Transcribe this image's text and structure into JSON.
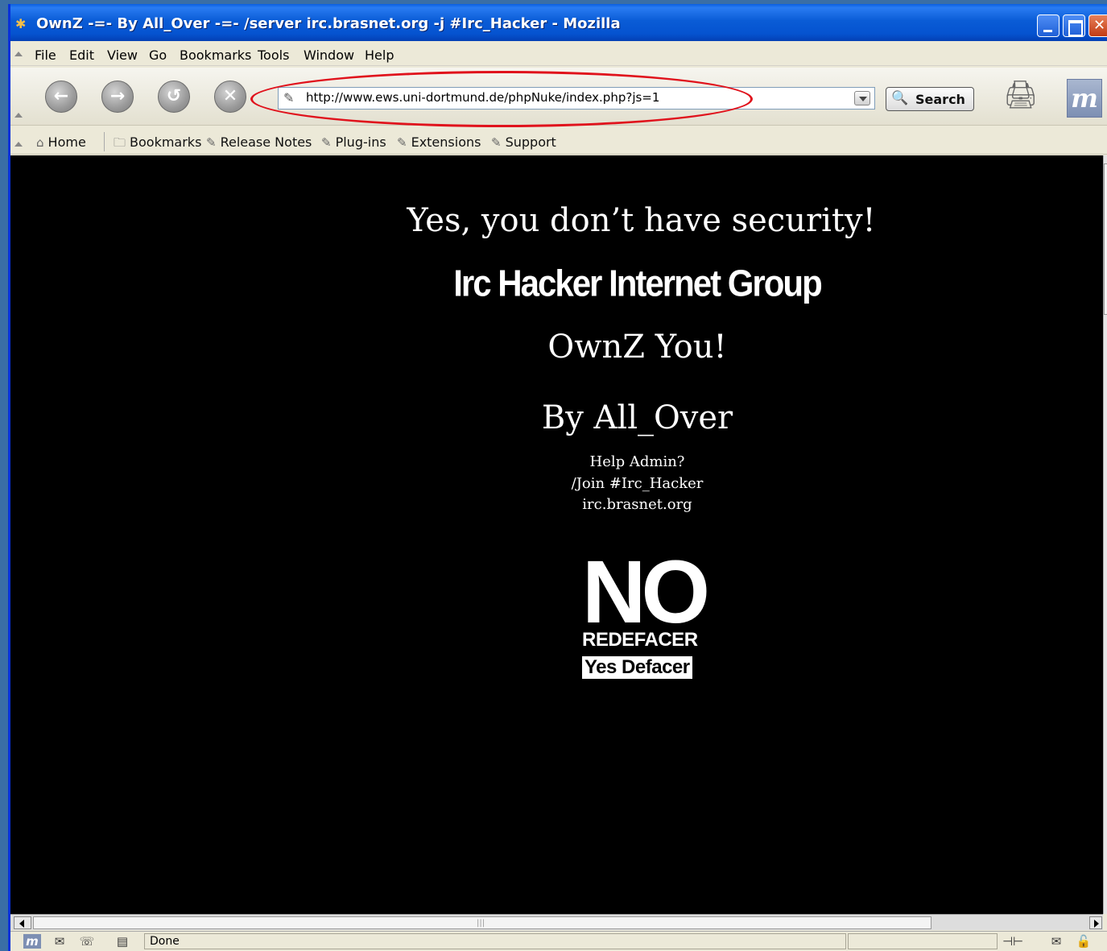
{
  "window": {
    "title": "OwnZ -=- By All_Over -=- /server irc.brasnet.org -j #Irc_Hacker - Mozilla"
  },
  "menu": {
    "items": [
      "File",
      "Edit",
      "View",
      "Go",
      "Bookmarks",
      "Tools",
      "Window",
      "Help"
    ]
  },
  "navbar": {
    "url": "http://www.ews.uni-dortmund.de/phpNuke/index.php?js=1",
    "search_label": "Search"
  },
  "personal_toolbar": {
    "home": "Home",
    "bookmarks": "Bookmarks",
    "release_notes": "Release Notes",
    "plugins": "Plug-ins",
    "extensions": "Extensions",
    "support": "Support"
  },
  "page": {
    "headline": "Yes, you don’t have security!",
    "group": "Irc Hacker Internet Group",
    "ownz": "OwnZ You!",
    "by": "By All_Over",
    "help_line1": "Help Admin?",
    "help_line2": "/Join #Irc_Hacker",
    "help_line3": "irc.brasnet.org",
    "badge_no": "NO",
    "badge_redefacer": "REDEFACER",
    "badge_yes": "Yes Defacer"
  },
  "status": {
    "text": "Done"
  },
  "colors": {
    "annotation_oval": "#e0121c",
    "content_background": "#000000",
    "titlebar_blue": "#0a5cd6"
  }
}
